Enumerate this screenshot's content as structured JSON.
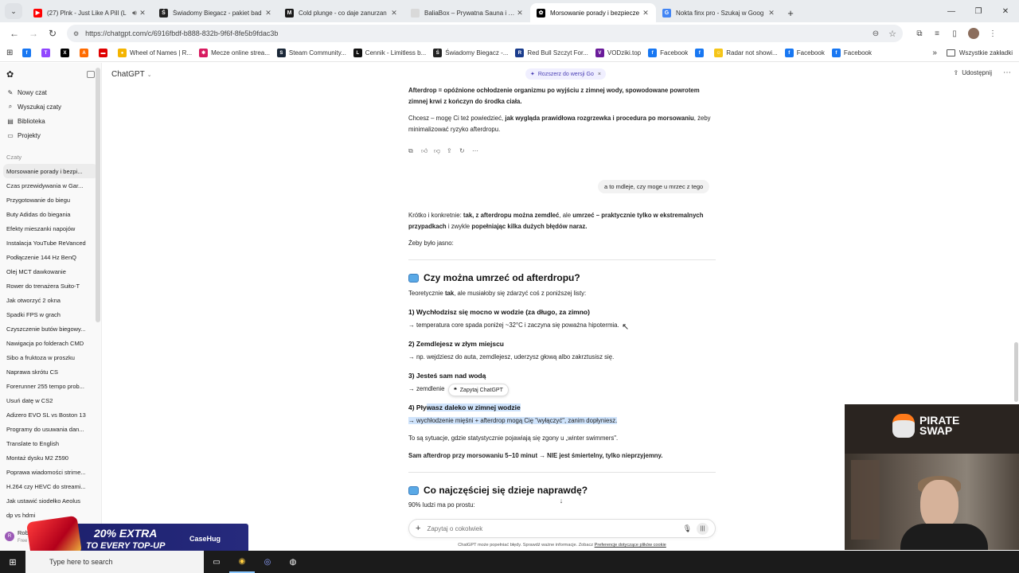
{
  "browser": {
    "tabs": [
      {
        "title": "(27) Plnk - Just Like A Pill (L",
        "favicon_color": "#ff0000",
        "favicon_glyph": "▶",
        "audio": true,
        "active": false
      },
      {
        "title": "Świadomy Biegacz - pakiet bad",
        "favicon_color": "#222222",
        "favicon_glyph": "Ś",
        "audio": false,
        "active": false
      },
      {
        "title": "Cold plunge - co daje zanurzan",
        "favicon_color": "#1a1a1a",
        "favicon_glyph": "M",
        "audio": false,
        "active": false
      },
      {
        "title": "BaliaBox – Prywatna Sauna i Bal",
        "favicon_color": "#d9d9d9",
        "favicon_glyph": "",
        "audio": false,
        "active": false
      },
      {
        "title": "Morsowanie porady i bezpiecze",
        "favicon_color": "#000000",
        "favicon_glyph": "✿",
        "audio": false,
        "active": true
      },
      {
        "title": "Nokta finx pro - Szukaj w Goog",
        "favicon_color": "#4285f4",
        "favicon_glyph": "G",
        "audio": false,
        "active": false
      }
    ],
    "url": "https://chatgpt.com/c/6916fbdf-b888-832b-9f6f-8fe5b9fdac3b",
    "bookmarks": [
      {
        "label": "",
        "color": "#1877f2",
        "glyph": "f"
      },
      {
        "label": "",
        "color": "#9146ff",
        "glyph": "T"
      },
      {
        "label": "",
        "color": "#000000",
        "glyph": "X"
      },
      {
        "label": "",
        "color": "#ff6b00",
        "glyph": "A"
      },
      {
        "label": "",
        "color": "#e00000",
        "glyph": "▬"
      },
      {
        "label": "Wheel of Names | R...",
        "color": "#f4b400",
        "glyph": "●"
      },
      {
        "label": "Mecze online strea...",
        "color": "#d81b60",
        "glyph": "✱"
      },
      {
        "label": "Steam Community...",
        "color": "#1b2838",
        "glyph": "S"
      },
      {
        "label": "Cennik - Limitless b...",
        "color": "#111111",
        "glyph": "L"
      },
      {
        "label": "Świadomy Biegacz -...",
        "color": "#222222",
        "glyph": "Ś"
      },
      {
        "label": "Red Bull Szczyt For...",
        "color": "#1a3c8c",
        "glyph": "R"
      },
      {
        "label": "VODziki.top",
        "color": "#6a1b9a",
        "glyph": "V"
      },
      {
        "label": "Facebook",
        "color": "#1877f2",
        "glyph": "f"
      },
      {
        "label": "",
        "color": "#1877f2",
        "glyph": "f"
      },
      {
        "label": "Radar not showi...",
        "color": "#f5c518",
        "glyph": "☺"
      },
      {
        "label": "Facebook",
        "color": "#1877f2",
        "glyph": "f"
      },
      {
        "label": "Facebook",
        "color": "#1877f2",
        "glyph": "f"
      }
    ],
    "bookmarks_all": "Wszystkie zakładki"
  },
  "sidebar": {
    "nav": [
      {
        "label": "Nowy czat",
        "icon": "edit-icon",
        "glyph": "✎"
      },
      {
        "label": "Wyszukaj czaty",
        "icon": "search-icon",
        "glyph": "⌕"
      },
      {
        "label": "Biblioteka",
        "icon": "library-icon",
        "glyph": "▤"
      },
      {
        "label": "Projekty",
        "icon": "folder-icon",
        "glyph": "▭"
      }
    ],
    "chats_heading": "Czaty",
    "chats": [
      "Morsowanie porady i bezpi...",
      "Czas przewidywania w Gar...",
      "Przygotowanie do biegu",
      "Buty Adidas do biegania",
      "Efekty mieszanki napojów",
      "Instalacja YouTube ReVanced",
      "Podłączenie 144 Hz BenQ",
      "Olej MCT dawkowanie",
      "Rower do trenażera Suito-T",
      "Jak otworzyć 2 okna",
      "Spadki FPS w grach",
      "Czyszczenie butów biegowy...",
      "Nawigacja po folderach CMD",
      "Sibo a fruktoza w proszku",
      "Naprawa skrótu CS",
      "Forerunner 255 tempo prob...",
      "Usuń datę w CS2",
      "Adizero EVO SL vs Boston 13",
      "Programy do usuwania dan...",
      "Translate to English",
      "Montaż dysku M2 Z590",
      "Poprawa wiadomości strime...",
      "H.264 czy HEVC do streami...",
      "Jak ustawić siodełko Aeolus",
      "dp vs hdmi"
    ],
    "user_name": "Rober",
    "user_initial": "R",
    "user_plan": "Free"
  },
  "chat": {
    "model": "ChatGPT",
    "upgrade": "Rozszerz do wersji Go",
    "share": "Udostępnij",
    "user_message": "a to mdleje, czy moge u mrzec z tego",
    "selection_popup": "Zapytaj ChatGPT",
    "composer_placeholder": "Zapytaj o cokolwiek",
    "disclaimer_text": "ChatGPT może popełniać błędy. Sprawdź ważne informacje. Zobacz",
    "disclaimer_link": "Preferencje dotyczące plików cookie",
    "messages": {
      "a1_b": "Afterdrop = opóźnione ochłodzenie organizmu po wyjściu z zimnej wody, spowodowane powrotem zimnej krwi z kończyn do środka ciała.",
      "a2_1": "Chcesz – mogę Ci też powiedzieć, ",
      "a2_b": "jak wygląda prawidłowa rozgrzewka i procedura po morsowaniu",
      "a2_2": ", żeby minimalizować ryzyko afterdropu.",
      "r1_1": "Krótko i konkretnie: ",
      "r1_b1": "tak, z afterdropu można zemdleć",
      "r1_2": ", ale ",
      "r1_b2": "umrzeć – praktycznie tylko w ekstremalnych przypadkach",
      "r1_3": " i zwykle ",
      "r1_b3": "popełniając kilka dużych błędów naraz.",
      "r2": "Żeby było jasno:",
      "h1": "Czy można umrzeć od afterdropu?",
      "r3_1": "Teoretycznie ",
      "r3_b": "tak",
      "r3_2": ", ale musiałoby się zdarzyć coś z poniższej listy:",
      "i1_h": "1) Wychłodzisz się mocno w wodzie (za długo, za zimno)",
      "i1_t": "→ temperatura core spada poniżej ~32°C i zaczyna się poważna hipotermia.",
      "i2_h": "2) Zemdlejesz w złym miejscu",
      "i2_t": "→ np. wejdziesz do auta, zemdlejesz, uderzysz głową albo zakrztusisz się.",
      "i3_h": "3) Jesteś sam nad wodą",
      "i3_t": "→ zemdlenie",
      "i4_h1": "4) Pły",
      "i4_h2": "wasz daleko w zimnej wodzie",
      "i4_t": "→ wychłodzenie mięśni + afterdrop mogą Cię \"wyłączyć\", zanim dopłyniesz.",
      "r4": "To są sytuacje, gdzie statystycznie pojawiają się zgony u „winter swimmers\".",
      "r5": "Sam afterdrop przy morsowaniu 5–10 minut → NIE jest śmiertelny, tylko nieprzyjemny.",
      "h2": "Co najczęściej się dzieje naprawdę?",
      "r6": "90% ludzi ma po prostu:"
    }
  },
  "overlays": {
    "cam_brand_1": "PIRATE",
    "cam_brand_2": "SWAP",
    "promo_line_1": "20% EXTRA",
    "promo_line_2": "TO EVERY TOP-UP",
    "promo_brand": "CaseHug"
  },
  "taskbar": {
    "search_placeholder": "Type here to search"
  },
  "colors": {
    "selection": "#cfe3fb",
    "upgrade_text": "#4a3fb5",
    "taskbar": "#1b1b1b"
  }
}
